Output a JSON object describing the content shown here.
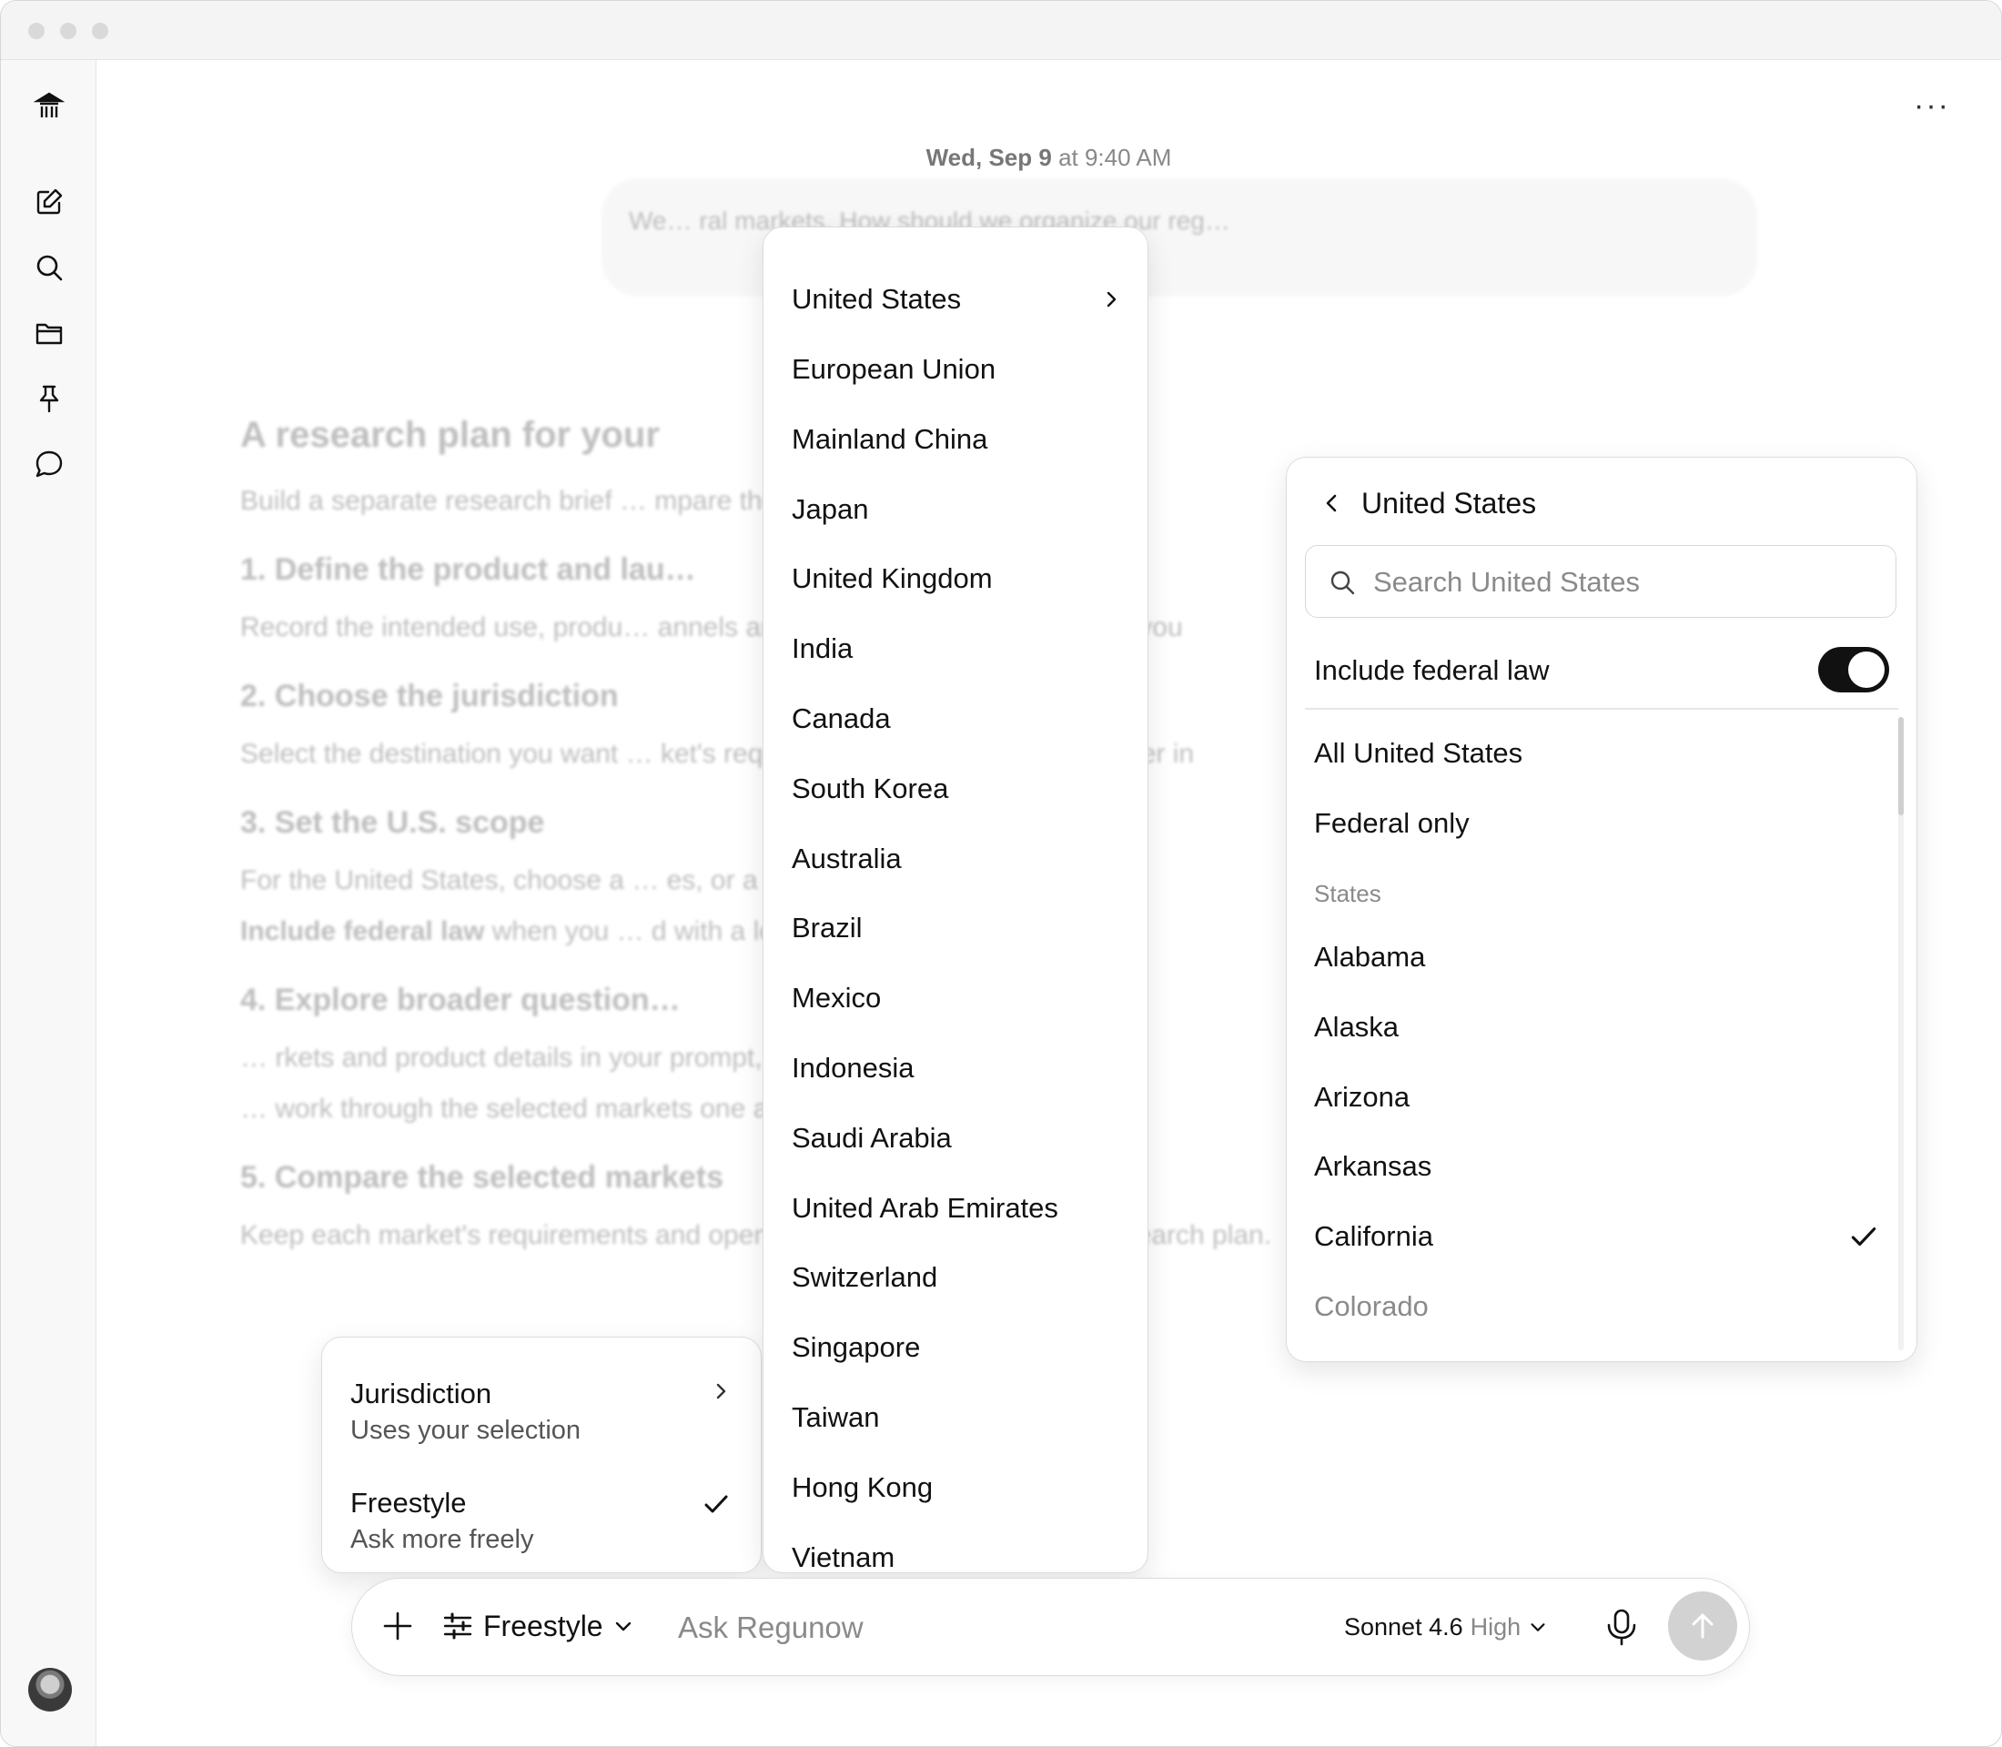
{
  "window": {
    "title": ""
  },
  "sidebar": {
    "items": [
      {
        "icon": "app-logo-icon"
      },
      {
        "icon": "new-chat-icon"
      },
      {
        "icon": "search-icon"
      },
      {
        "icon": "folder-icon"
      },
      {
        "icon": "pin-icon"
      },
      {
        "icon": "chat-bubble-icon"
      }
    ],
    "avatar": "user-avatar"
  },
  "header": {
    "more_label": "···"
  },
  "conversation": {
    "timestamp_day": "Wed, Sep 9",
    "timestamp_rest": " at 9:40 AM",
    "user_message": "We… ral markets. How should we organize our reg…",
    "answer": {
      "title": "A research plan for your",
      "intro": "Build a separate research brief … mpare the product specification.",
      "s1_title": "1. Define the product and lau…",
      "s1_body": "Record the intended use, produ… annels an… those details consistent as you",
      "s2_title": "2. Choose the jurisdiction",
      "s2_body": "Select the destination you want … ket's requi… and open questions together in",
      "s3_title": "3. Set the U.S. scope",
      "s3_body_a": "For the United States, choose a … es, or a st…",
      "s3_body_bold": "Include federal law",
      "s3_body_b": " when you … d with a lo…",
      "s4_title": "4. Explore broader question…",
      "s4_body": "… rkets and product details in your prompt, … ngs.",
      "s4_body2": "… work through the selected markets one at a time.",
      "s5_title": "5. Compare the selected markets",
      "s5_body": "Keep each market's requirements and open questions together in your research plan."
    }
  },
  "country_menu": {
    "items": [
      "United States",
      "European Union",
      "Mainland China",
      "Japan",
      "United Kingdom",
      "India",
      "Canada",
      "South Korea",
      "Australia",
      "Brazil",
      "Mexico",
      "Indonesia",
      "Saudi Arabia",
      "United Arab Emirates",
      "Switzerland",
      "Singapore",
      "Taiwan",
      "Hong Kong",
      "Vietnam"
    ]
  },
  "mode_menu": {
    "jurisdiction_title": "Jurisdiction",
    "jurisdiction_sub": "Uses your selection",
    "freestyle_title": "Freestyle",
    "freestyle_sub": "Ask more freely",
    "selected": "Freestyle"
  },
  "us_panel": {
    "back_title": "United States",
    "search_placeholder": "Search United States",
    "federal_label": "Include federal law",
    "federal_on": true,
    "all_label": "All United States",
    "federal_only_label": "Federal only",
    "group_label": "States",
    "states": [
      "Alabama",
      "Alaska",
      "Arizona",
      "Arkansas",
      "California",
      "Colorado"
    ],
    "selected_state": "California"
  },
  "composer": {
    "mode_label": "Freestyle",
    "placeholder": "Ask Regunow",
    "model_name": "Sonnet 4.6",
    "model_effort": "High"
  },
  "colors": {
    "accent": "#111111",
    "muted": "#8a8a8a",
    "send_disabled": "#d2d2d2"
  }
}
